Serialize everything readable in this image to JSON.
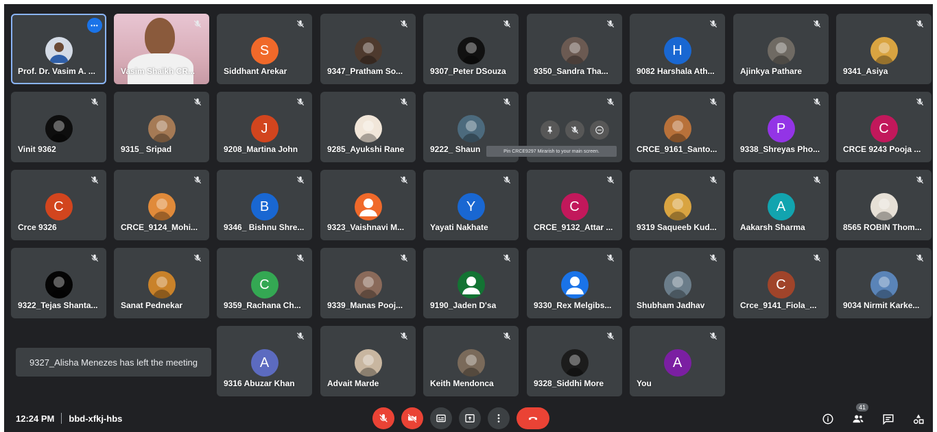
{
  "meeting": {
    "time": "12:24 PM",
    "code": "bbd-xfkj-hbs",
    "participant_count": "41"
  },
  "toast": "9327_Alisha Menezes has left the meeting",
  "tooltip": "Pin CRCE9297 Mirarish to your main screen.",
  "colors": {
    "background": "#202124",
    "tile": "#3c4043",
    "end_call": "#ea4335",
    "active_outline": "#8ab4f8"
  },
  "tiles": [
    {
      "name": "Prof. Dr. Vasim A. ...",
      "initial": "",
      "avatar_color": "#d4dbe6",
      "avatar_icon": "person-photo-icon"
    },
    {
      "name": "Vasim Shaikh CR...",
      "initial": "",
      "avatar_color": "",
      "avatar_icon": "video-feed"
    },
    {
      "name": "Siddhant Arekar",
      "initial": "S",
      "avatar_color": "#f0692a"
    },
    {
      "name": "9347_Pratham So...",
      "initial": "",
      "avatar_color": "#4e3a2e",
      "avatar_icon": "photo-icon"
    },
    {
      "name": "9307_Peter DSouza",
      "initial": "",
      "avatar_color": "#111111",
      "avatar_icon": "emblem-icon"
    },
    {
      "name": "9350_Sandra Tha...",
      "initial": "",
      "avatar_color": "#6b5a52",
      "avatar_icon": "photo-icon"
    },
    {
      "name": "9082 Harshala Ath...",
      "initial": "H",
      "avatar_color": "#1967d2"
    },
    {
      "name": "Ajinkya Pathare",
      "initial": "",
      "avatar_color": "#6f6a63",
      "avatar_icon": "photo-icon"
    },
    {
      "name": "9341_Asiya",
      "initial": "",
      "avatar_color": "#d9a441",
      "avatar_icon": "doge-icon"
    },
    {
      "name": "Vinit 9362",
      "initial": "",
      "avatar_color": "#0e0e0e",
      "avatar_icon": "logo-icon"
    },
    {
      "name": "9315_ Sripad",
      "initial": "",
      "avatar_color": "#a57a55",
      "avatar_icon": "photo-icon"
    },
    {
      "name": "9208_Martina John",
      "initial": "J",
      "avatar_color": "#d2451e"
    },
    {
      "name": "9285_Ayukshi Rane",
      "initial": "",
      "avatar_color": "#f1e6d9",
      "avatar_icon": "cartoon-icon"
    },
    {
      "name": "9222_ Shaun",
      "initial": "",
      "avatar_color": "#4c6a7d",
      "avatar_icon": "photo-icon"
    },
    {
      "name": "",
      "initial": "",
      "avatar_color": "",
      "avatar_icon": "hover-controls"
    },
    {
      "name": "CRCE_9161_Santo...",
      "initial": "",
      "avatar_color": "#b8713a",
      "avatar_icon": "photo-icon"
    },
    {
      "name": "9338_Shreyas Pho...",
      "initial": "P",
      "avatar_color": "#9334e6"
    },
    {
      "name": "CRCE 9243 Pooja ...",
      "initial": "C",
      "avatar_color": "#c2185b"
    },
    {
      "name": "Crce 9326",
      "initial": "C",
      "avatar_color": "#d2451e"
    },
    {
      "name": "CRCE_9124_Mohi...",
      "initial": "",
      "avatar_color": "#e08a3a",
      "avatar_icon": "sunset-icon"
    },
    {
      "name": "9346_ Bishnu Shre...",
      "initial": "B",
      "avatar_color": "#1967d2"
    },
    {
      "name": "9323_Vaishnavi M...",
      "initial": "",
      "avatar_color": "#f0692a",
      "avatar_icon": "person-icon"
    },
    {
      "name": "Yayati Nakhate",
      "initial": "Y",
      "avatar_color": "#1967d2"
    },
    {
      "name": "CRCE_9132_Attar ...",
      "initial": "C",
      "avatar_color": "#c2185b"
    },
    {
      "name": "9319 Saqueeb Kud...",
      "initial": "",
      "avatar_color": "#d9a441",
      "avatar_icon": "doge-icon"
    },
    {
      "name": "Aakarsh Sharma",
      "initial": "A",
      "avatar_color": "#12a4af"
    },
    {
      "name": "8565 ROBIN Thom...",
      "initial": "",
      "avatar_color": "#e6e0d6",
      "avatar_icon": "photo-icon"
    },
    {
      "name": "9322_Tejas Shanta...",
      "initial": "",
      "avatar_color": "#050505",
      "avatar_icon": "logo-icon"
    },
    {
      "name": "Sanat Pednekar",
      "initial": "",
      "avatar_color": "#c9822a",
      "avatar_icon": "photo-icon"
    },
    {
      "name": "9359_Rachana Ch...",
      "initial": "C",
      "avatar_color": "#34a853"
    },
    {
      "name": "9339_Manas Pooj...",
      "initial": "",
      "avatar_color": "#8a6a5a",
      "avatar_icon": "photo-icon"
    },
    {
      "name": "9190_Jaden D'sa",
      "initial": "",
      "avatar_color": "#137333",
      "avatar_icon": "person-icon"
    },
    {
      "name": "9330_Rex Melgibs...",
      "initial": "",
      "avatar_color": "#1a73e8",
      "avatar_icon": "person-icon"
    },
    {
      "name": "Shubham Jadhav",
      "initial": "",
      "avatar_color": "#6b7d8a",
      "avatar_icon": "photo-icon"
    },
    {
      "name": "Crce_9141_Fiola_...",
      "initial": "C",
      "avatar_color": "#a0442a"
    },
    {
      "name": "9034 Nirmit Karke...",
      "initial": "",
      "avatar_color": "#5a84b8",
      "avatar_icon": "photo-icon"
    },
    {
      "name": "9316 Abuzar Khan",
      "initial": "A",
      "avatar_color": "#5c6bc0"
    },
    {
      "name": "Advait Marde",
      "initial": "",
      "avatar_color": "#c8b6a0",
      "avatar_icon": "photo-icon"
    },
    {
      "name": "Keith Mendonca",
      "initial": "",
      "avatar_color": "#7a6a5a",
      "avatar_icon": "photo-icon"
    },
    {
      "name": "9328_Siddhi More",
      "initial": "",
      "avatar_color": "#1c1c1c",
      "avatar_icon": "anime-icon"
    },
    {
      "name": "You",
      "initial": "A",
      "avatar_color": "#7b1fa2"
    }
  ]
}
